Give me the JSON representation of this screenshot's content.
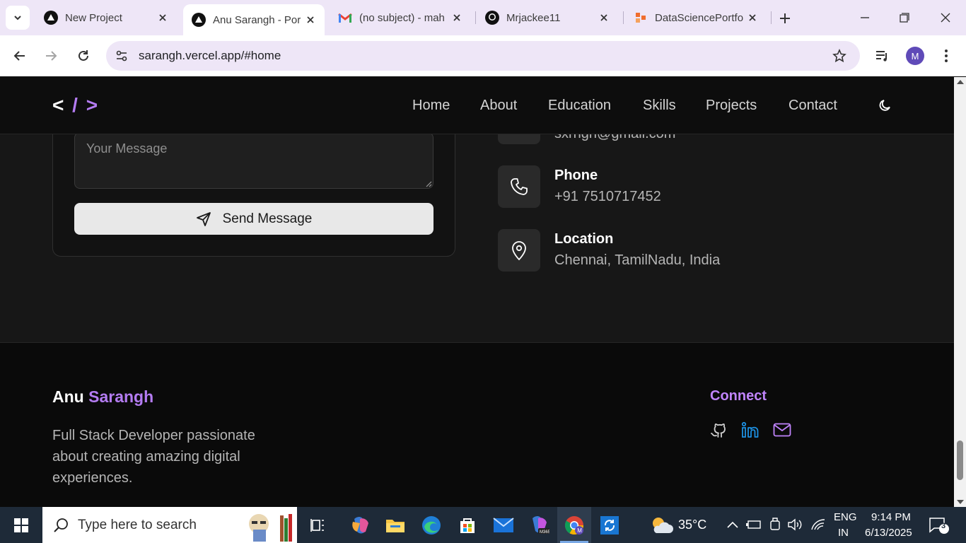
{
  "browser": {
    "tabs": [
      {
        "title": "New Project",
        "icon": "vercel-triangle-icon",
        "active": false
      },
      {
        "title": "Anu Sarangh - Por",
        "icon": "vercel-triangle-icon",
        "active": true
      },
      {
        "title": "(no subject) - mah",
        "icon": "gmail-icon",
        "active": false
      },
      {
        "title": "Mrjackee11",
        "icon": "github-icon",
        "active": false
      },
      {
        "title": "DataSciencePortfo",
        "icon": "portfolio-icon",
        "active": false
      }
    ],
    "url": "sarangh.vercel.app/#home",
    "profile_initial": "M"
  },
  "site": {
    "logo": {
      "open": "<",
      "slash": "/",
      "close": ">"
    },
    "nav": [
      "Home",
      "About",
      "Education",
      "Skills",
      "Projects",
      "Contact"
    ],
    "contact_form": {
      "message_placeholder": "Your Message",
      "send_label": "Send Message"
    },
    "contact_info": {
      "email_partial": "sxrngh@gmail.com",
      "phone_label": "Phone",
      "phone_value": "+91 7510717452",
      "location_label": "Location",
      "location_value": "Chennai, TamilNadu, India"
    },
    "footer": {
      "name_first": "Anu",
      "name_last": "Sarangh",
      "description": "Full Stack Developer passionate about creating amazing digital experiences.",
      "connect_title": "Connect",
      "socials": [
        "github-icon",
        "linkedin-icon",
        "mail-icon"
      ]
    },
    "colors": {
      "accent": "#b47cf2",
      "background": "#171717",
      "footer": "#0a0a0a"
    }
  },
  "taskbar": {
    "search_placeholder": "Type here to search",
    "weather": "35°C",
    "language_line1": "ENG",
    "language_line2": "IN",
    "time": "9:14 PM",
    "date": "6/13/2025",
    "notification_count": "3"
  }
}
